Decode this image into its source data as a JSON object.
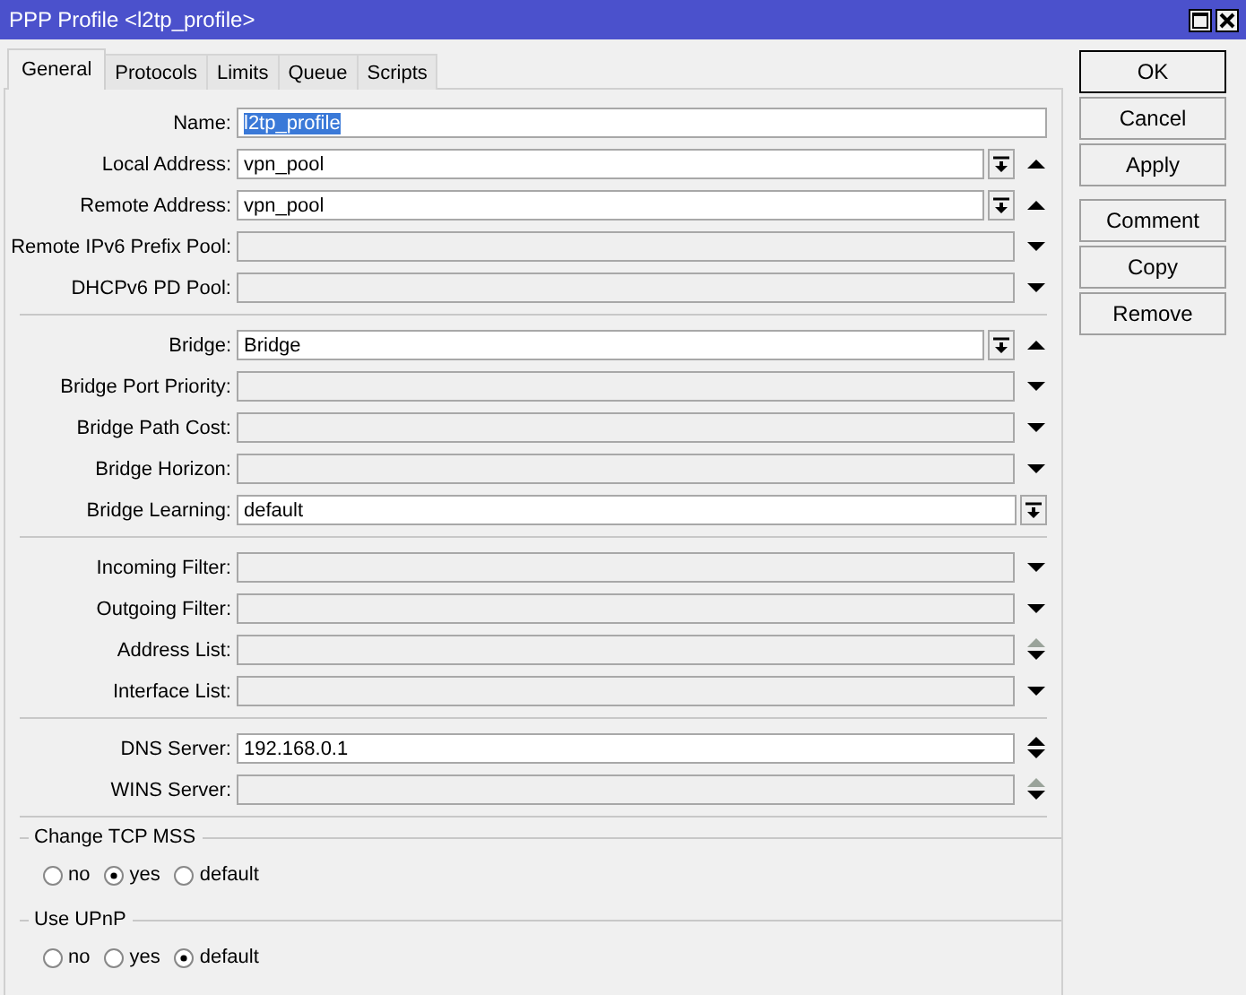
{
  "window": {
    "title": "PPP Profile <l2tp_profile>"
  },
  "tabs": [
    {
      "label": "General",
      "selected": true
    },
    {
      "label": "Protocols",
      "selected": false
    },
    {
      "label": "Limits",
      "selected": false
    },
    {
      "label": "Queue",
      "selected": false
    },
    {
      "label": "Scripts",
      "selected": false
    }
  ],
  "field_groups": [
    [
      {
        "label": "Name:",
        "value": "l2tp_profile",
        "text_selected": true
      },
      {
        "label": "Local Address:",
        "value": "vpn_pool",
        "text_selected": false,
        "controls": [
          {
            "kind": "pick"
          },
          {
            "kind": "up"
          }
        ]
      },
      {
        "label": "Remote Address:",
        "value": "vpn_pool",
        "text_selected": false,
        "controls": [
          {
            "kind": "pick"
          },
          {
            "kind": "up"
          }
        ]
      },
      {
        "label": "Remote IPv6 Prefix Pool:",
        "controls": [
          {
            "kind": "down"
          }
        ]
      },
      {
        "label": "DHCPv6 PD Pool:",
        "controls": [
          {
            "kind": "down"
          }
        ]
      }
    ],
    [
      {
        "label": "Bridge:",
        "value": "Bridge",
        "text_selected": false,
        "controls": [
          {
            "kind": "pick"
          },
          {
            "kind": "up"
          }
        ]
      },
      {
        "label": "Bridge Port Priority:",
        "controls": [
          {
            "kind": "down"
          }
        ]
      },
      {
        "label": "Bridge Path Cost:",
        "controls": [
          {
            "kind": "down"
          }
        ]
      },
      {
        "label": "Bridge Horizon:",
        "controls": [
          {
            "kind": "down"
          }
        ]
      },
      {
        "label": "Bridge Learning:",
        "value": "default",
        "text_selected": false,
        "controls": [
          {
            "kind": "pick"
          }
        ]
      }
    ],
    [
      {
        "label": "Incoming Filter:",
        "controls": [
          {
            "kind": "down"
          }
        ]
      },
      {
        "label": "Outgoing Filter:",
        "controls": [
          {
            "kind": "down"
          }
        ]
      },
      {
        "label": "Address List:",
        "controls": [
          {
            "kind": "updown-dim"
          }
        ]
      },
      {
        "label": "Interface List:",
        "controls": [
          {
            "kind": "down"
          }
        ]
      }
    ],
    [
      {
        "label": "DNS Server:",
        "value": "192.168.0.1",
        "text_selected": false,
        "controls": [
          {
            "kind": "updown"
          }
        ]
      },
      {
        "label": "WINS Server:",
        "controls": [
          {
            "kind": "updown-dim"
          }
        ]
      }
    ]
  ],
  "radio_groups": [
    {
      "title": "Change TCP MSS",
      "options": [
        {
          "label": "no",
          "selected": false
        },
        {
          "label": "yes",
          "selected": true
        },
        {
          "label": "default",
          "selected": false
        }
      ]
    },
    {
      "title": "Use UPnP",
      "options": [
        {
          "label": "no",
          "selected": false
        },
        {
          "label": "yes",
          "selected": false
        },
        {
          "label": "default",
          "selected": true
        }
      ]
    }
  ],
  "buttons": [
    [
      "OK",
      "Cancel",
      "Apply"
    ],
    [
      "Comment",
      "Copy",
      "Remove"
    ]
  ]
}
